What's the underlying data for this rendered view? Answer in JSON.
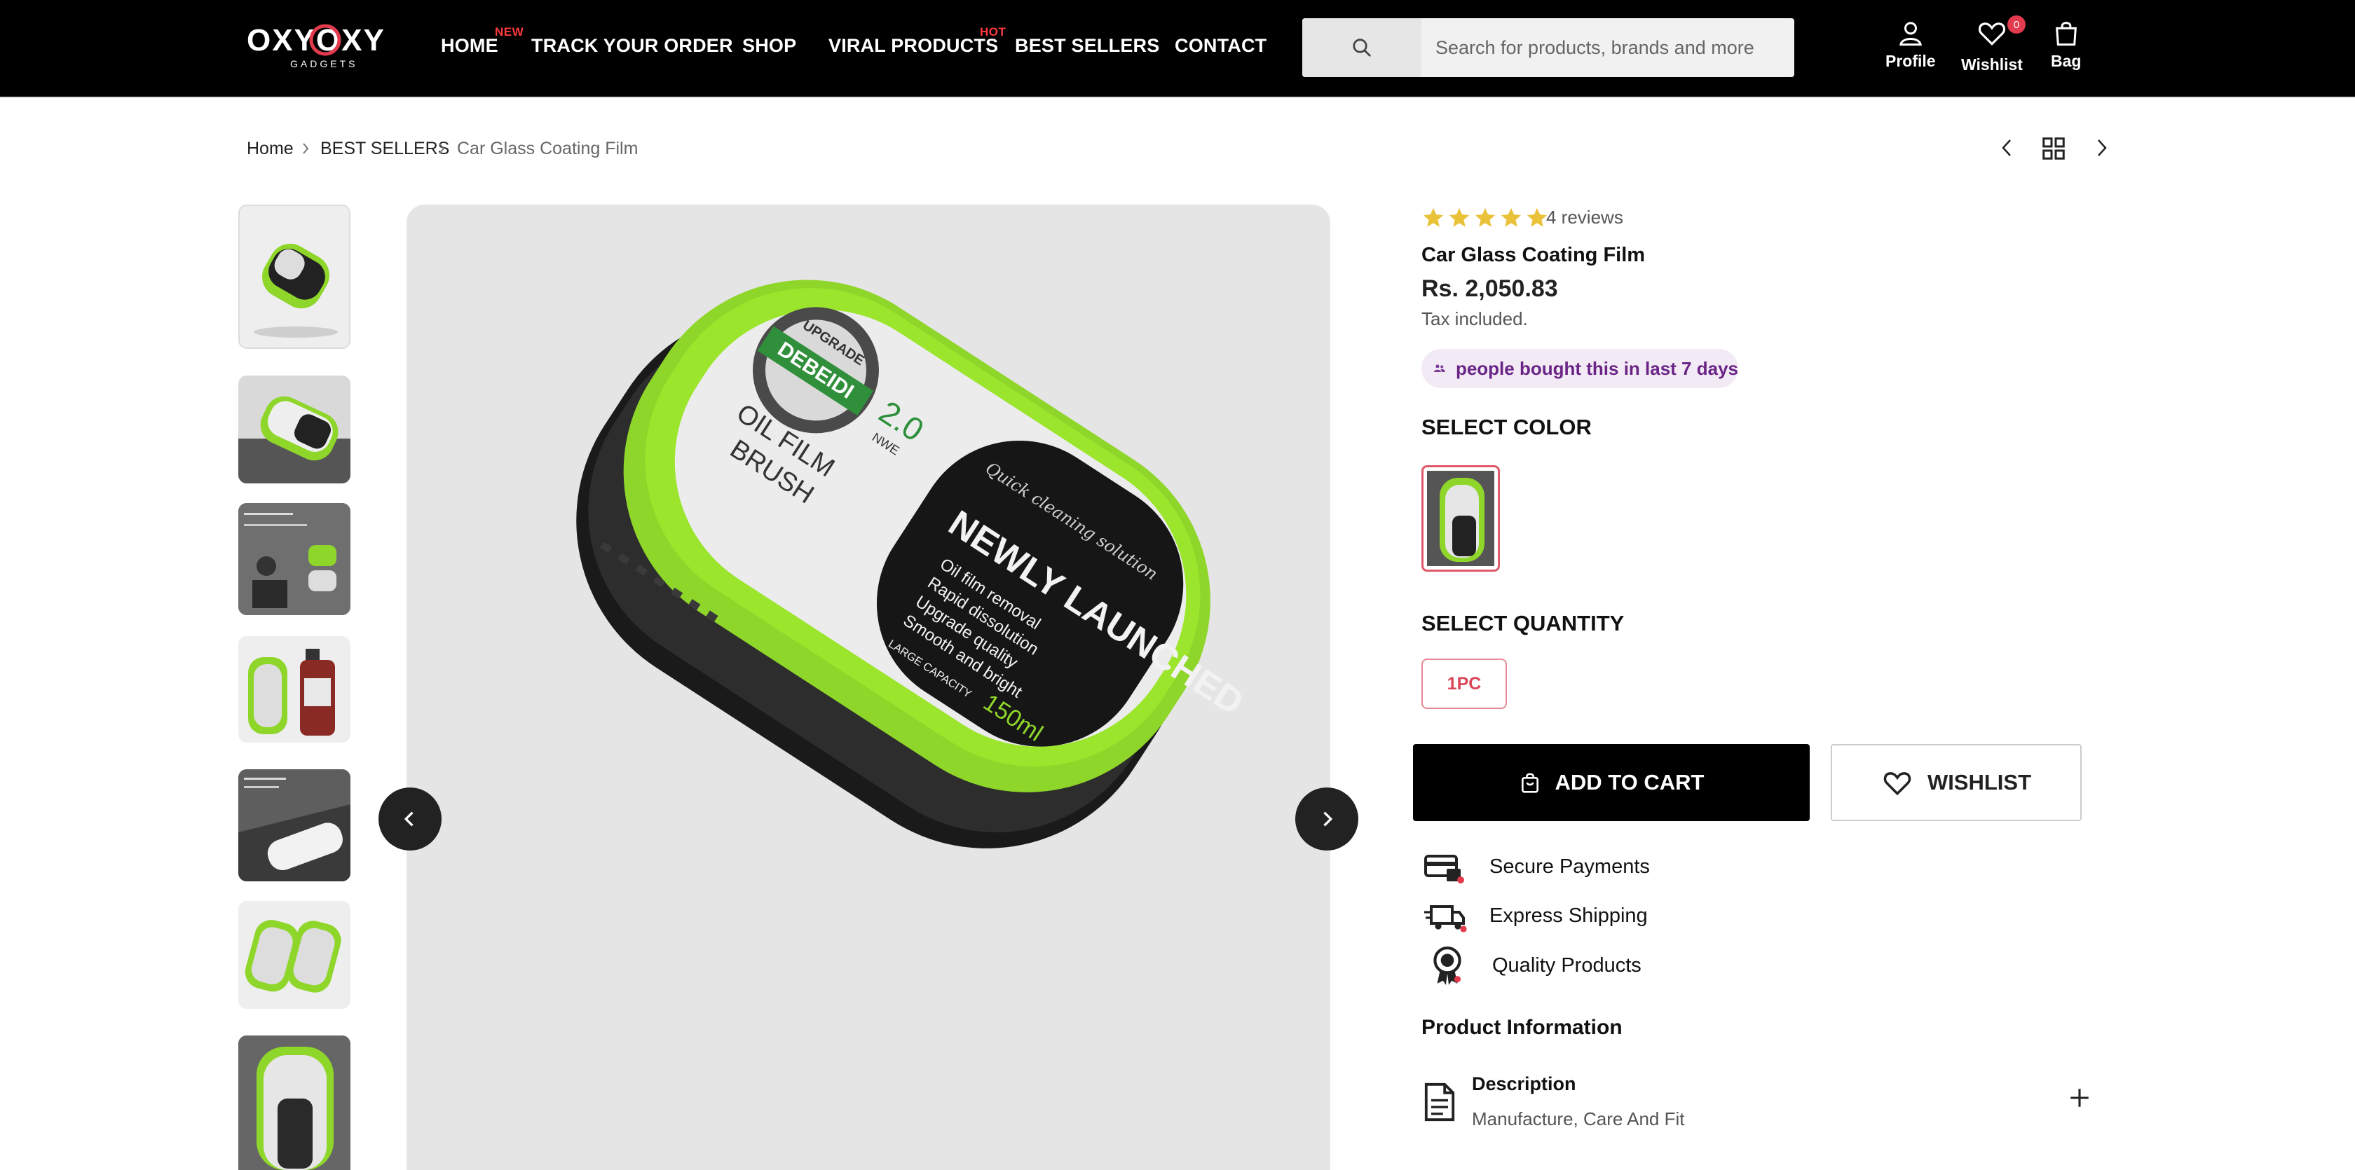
{
  "header": {
    "logo_text": "OXYOXY",
    "logo_sub": "GADGETS",
    "nav": [
      {
        "label": "HOME",
        "badge": "NEW"
      },
      {
        "label": "TRACK YOUR ORDER",
        "badge": ""
      },
      {
        "label": "SHOP",
        "badge": ""
      },
      {
        "label": "VIRAL PRODUCTS",
        "badge": "HOT"
      },
      {
        "label": "BEST SELLERS",
        "badge": ""
      },
      {
        "label": "CONTACT",
        "badge": ""
      }
    ],
    "search_placeholder": "Search for products, brands and more",
    "icons": {
      "profile": "Profile",
      "wishlist": "Wishlist",
      "wishlist_count": "0",
      "bag": "Bag"
    }
  },
  "breadcrumb": [
    "Home",
    "BEST SELLERS",
    "Car Glass Coating Film"
  ],
  "gallery": {
    "thumbnail_count": 7,
    "product_label": {
      "brand": "DEBEIDI",
      "seal": "UPGRADE",
      "version": "2.0",
      "new": "NWE",
      "line1": "OIL FILM",
      "line2": "BRUSH",
      "script": "Quick cleaning solution",
      "launch": "NEWLY LAUNCHED",
      "features": [
        "Oil film removal",
        "Rapid dissolution",
        "Upgrade quality",
        "Smooth and bright"
      ],
      "capacity_label": "LARGE CAPACITY",
      "capacity": "150ml"
    }
  },
  "product": {
    "rating": 5,
    "reviews_text": "4 reviews",
    "title": "Car Glass Coating Film",
    "price": "Rs. 2,050.83",
    "tax_note": "Tax included.",
    "bought_text": "people bought this in last 7 days",
    "select_color_label": "SELECT COLOR",
    "select_quantity_label": "SELECT QUANTITY",
    "quantity_option": "1PC",
    "add_to_cart": "ADD TO CART",
    "wishlist": "WISHLIST",
    "features": [
      "Secure Payments",
      "Express Shipping",
      "Quality Products"
    ],
    "product_information": "Product Information",
    "description_title": "Description",
    "description_sub": "Manufacture, Care And Fit"
  },
  "colors": {
    "accent_green": "#8fd62a",
    "star": "#e9c23a",
    "badge_purple": "#6a2486",
    "qty_red": "#d94659"
  }
}
